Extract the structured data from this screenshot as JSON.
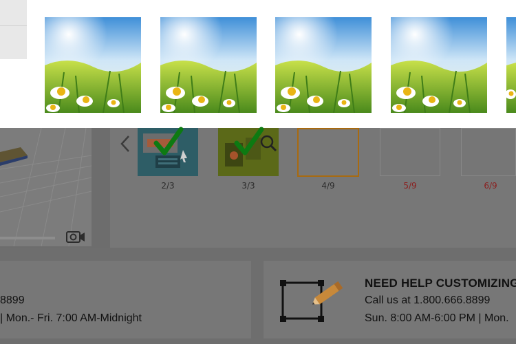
{
  "image_picker": {
    "thumbnails": [
      {
        "name": "daisy-photo"
      },
      {
        "name": "daisy-photo"
      },
      {
        "name": "daisy-photo"
      },
      {
        "name": "daisy-photo"
      }
    ]
  },
  "pages": {
    "labels": [
      "2/3",
      "3/3",
      "4/9",
      "5/9",
      "6/9"
    ],
    "label_colors": [
      "#2c2c2c",
      "#2c2c2c",
      "#2c2c2c",
      "#8b1e1e",
      "#8b1e1e"
    ]
  },
  "help": {
    "title": "NEED HELP CUSTOMIZING",
    "phone_line": "Call us at 1.800.666.8899",
    "hours_line": "Sun. 8:00 AM-6:00 PM | Mon."
  },
  "left_panel": {
    "phone_fragment": "8899",
    "hours_fragment": "| Mon.- Fri. 7:00 AM-Midnight"
  },
  "colors": {
    "overlay": "#6d6d6d",
    "active_page_border": "#a86a10",
    "check": "#0d7a12",
    "pencil": "#c8893a"
  },
  "icons": [
    "chevron-left-icon",
    "checkmark-icon",
    "camera-icon",
    "crop-icon",
    "pencil-icon"
  ]
}
